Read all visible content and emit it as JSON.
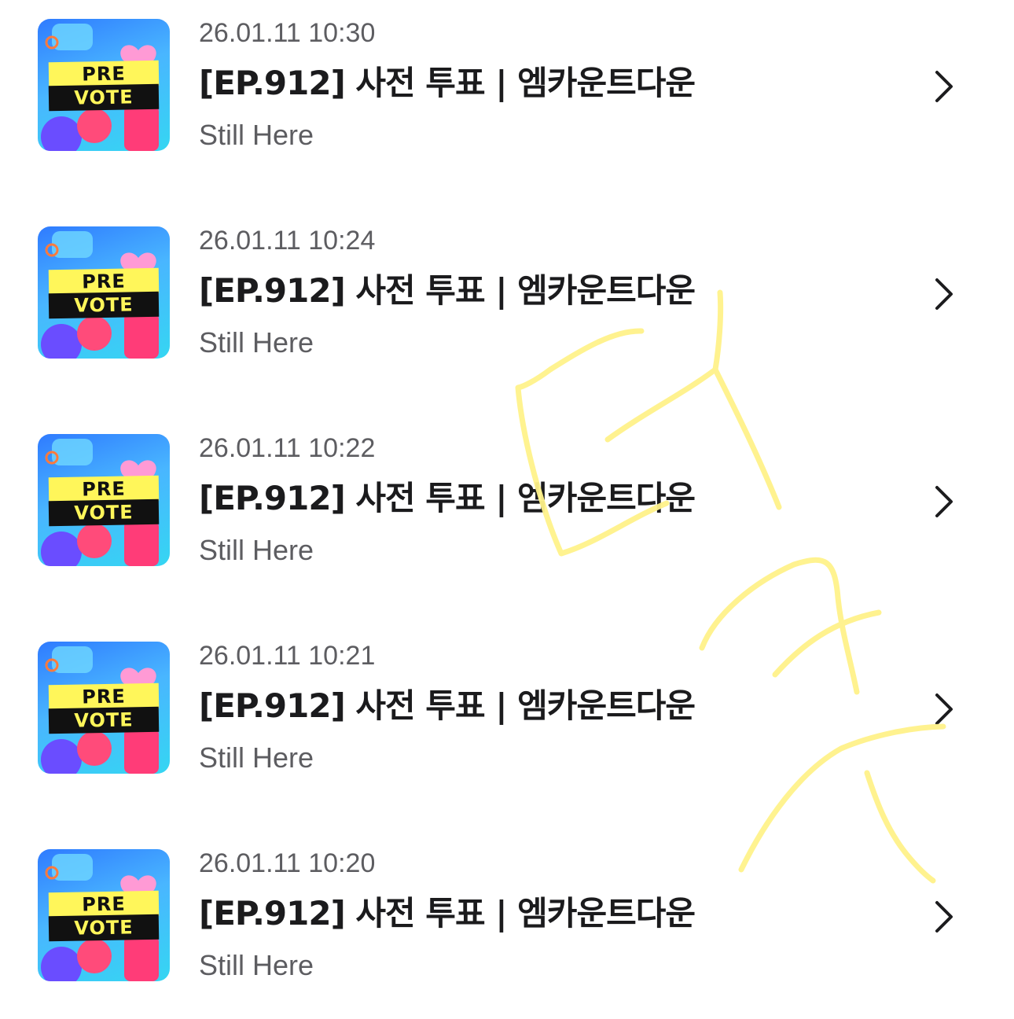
{
  "list": {
    "items": [
      {
        "date": "26.01.11 10:30",
        "title": "[EP.912] 사전 투표 | 엠카운트다운",
        "artist": "Still Here",
        "thumb": {
          "line1": "PRE",
          "line2": "VOTE"
        }
      },
      {
        "date": "26.01.11 10:24",
        "title": "[EP.912] 사전 투표 | 엠카운트다운",
        "artist": "Still Here",
        "thumb": {
          "line1": "PRE",
          "line2": "VOTE"
        }
      },
      {
        "date": "26.01.11 10:22",
        "title": "[EP.912] 사전 투표 | 엠카운트다운",
        "artist": "Still Here",
        "thumb": {
          "line1": "PRE",
          "line2": "VOTE"
        }
      },
      {
        "date": "26.01.11 10:21",
        "title": "[EP.912] 사전 투표 | 엠카운트다운",
        "artist": "Still Here",
        "thumb": {
          "line1": "PRE",
          "line2": "VOTE"
        }
      },
      {
        "date": "26.01.11 10:20",
        "title": "[EP.912] 사전 투표 | 엠카운트다운",
        "artist": "Still Here",
        "thumb": {
          "line1": "PRE",
          "line2": "VOTE"
        }
      }
    ],
    "chevron_icon": "chevron-right-icon"
  },
  "colors": {
    "scribble": "#fff28a",
    "thumb_yellow": "#fff65a",
    "thumb_black": "#111111",
    "secondary_text": "#5d5d61"
  }
}
